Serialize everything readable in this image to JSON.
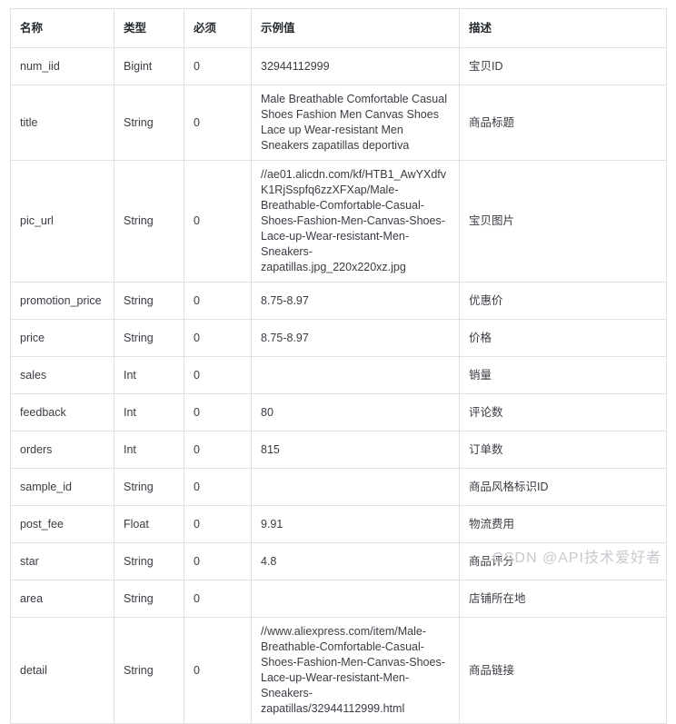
{
  "table": {
    "headers": [
      "名称",
      "类型",
      "必须",
      "示例值",
      "描述"
    ],
    "rows": [
      {
        "name": "num_iid",
        "type": "Bigint",
        "required": "0",
        "example": "32944112999",
        "desc": "宝贝ID",
        "tall": false
      },
      {
        "name": "title",
        "type": "String",
        "required": "0",
        "example": "Male Breathable Comfortable Casual Shoes Fashion Men Canvas Shoes Lace up Wear-resistant Men Sneakers zapatillas deportiva",
        "desc": "商品标题",
        "tall": true
      },
      {
        "name": "pic_url",
        "type": "String",
        "required": "0",
        "example": "//ae01.alicdn.com/kf/HTB1_AwYXdfvK1RjSspfq6zzXFXap/Male-Breathable-Comfortable-Casual-Shoes-Fashion-Men-Canvas-Shoes-Lace-up-Wear-resistant-Men-Sneakers-zapatillas.jpg_220x220xz.jpg",
        "desc": "宝贝图片",
        "tall": true
      },
      {
        "name": "promotion_price",
        "type": "String",
        "required": "0",
        "example": "8.75-8.97",
        "desc": "优惠价",
        "tall": false
      },
      {
        "name": "price",
        "type": "String",
        "required": "0",
        "example": "8.75-8.97",
        "desc": "价格",
        "tall": false
      },
      {
        "name": "sales",
        "type": "Int",
        "required": "0",
        "example": "",
        "desc": "销量",
        "tall": false
      },
      {
        "name": "feedback",
        "type": "Int",
        "required": "0",
        "example": "80",
        "desc": "评论数",
        "tall": false
      },
      {
        "name": "orders",
        "type": "Int",
        "required": "0",
        "example": "815",
        "desc": "订单数",
        "tall": false
      },
      {
        "name": "sample_id",
        "type": "String",
        "required": "0",
        "example": "",
        "desc": "商品风格标识ID",
        "tall": false
      },
      {
        "name": "post_fee",
        "type": "Float",
        "required": "0",
        "example": "9.91",
        "desc": "物流费用",
        "tall": false
      },
      {
        "name": "star",
        "type": "String",
        "required": "0",
        "example": "4.8",
        "desc": "商品评分",
        "tall": false
      },
      {
        "name": "area",
        "type": "String",
        "required": "0",
        "example": "",
        "desc": "店铺所在地",
        "tall": false
      },
      {
        "name": "detail",
        "type": "String",
        "required": "0",
        "example": "//www.aliexpress.com/item/Male-Breathable-Comfortable-Casual-Shoes-Fashion-Men-Canvas-Shoes-Lace-up-Wear-resistant-Men-Sneakers-zapatillas/32944112999.html",
        "desc": "商品链接",
        "tall": true
      }
    ]
  },
  "watermark": {
    "text": "CSDN @API技术爱好者"
  },
  "colors": {
    "border": "#dfe2e5",
    "text": "#3b3b44",
    "header_text": "#24292e",
    "watermark": "#c9c9cf",
    "background": "#ffffff"
  }
}
